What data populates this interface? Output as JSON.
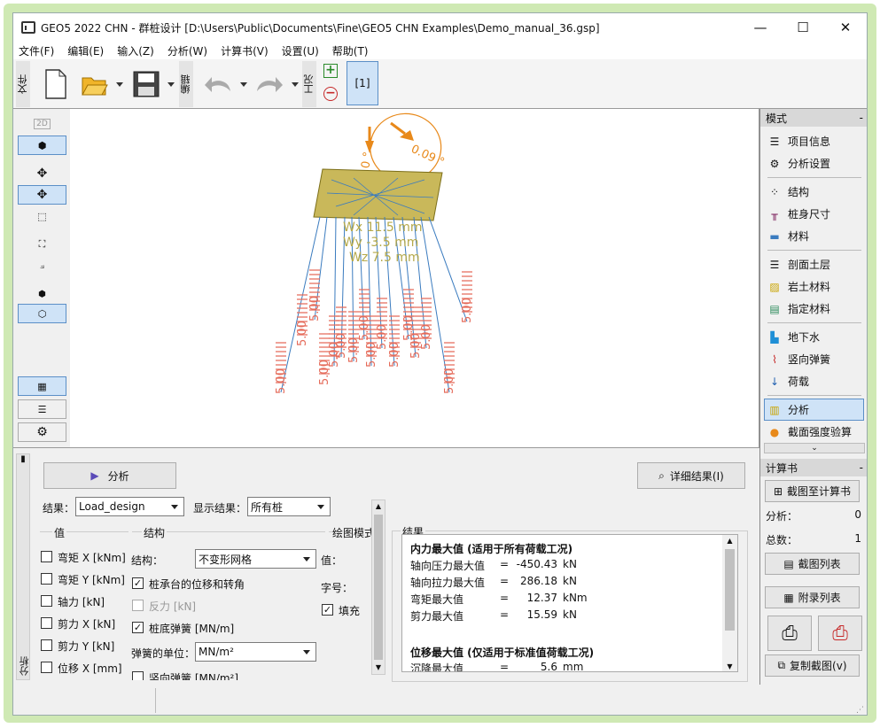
{
  "window": {
    "title": "GEO5 2022 CHN - 群桩设计 [D:\\Users\\Public\\Documents\\Fine\\GEO5 CHN Examples\\Demo_manual_36.gsp]",
    "minimize": "—",
    "maximize": "☐",
    "close": "✕"
  },
  "menu": [
    "文件(F)",
    "编辑(E)",
    "输入(Z)",
    "分析(W)",
    "计算书(V)",
    "设置(U)",
    "帮助(T)"
  ],
  "toolbar": {
    "file_label": "文件",
    "edit_label": "编辑",
    "stage_label": "工况",
    "stage_tab": "[1]"
  },
  "canvas": {
    "wx": "Wx 11.5 mm",
    "wy": "Wy -3.5 mm",
    "wz": "Wz 7.5 mm",
    "rot_label": "0.09 °",
    "rot2_label": "0.0 °",
    "springs": [
      "5.00",
      "5.00",
      "5.00",
      "5.00",
      "5.00",
      "5.00",
      "5.00",
      "5.00",
      "5.00",
      "5.00",
      "5.00",
      "5.00",
      "5.00",
      "5.00",
      "5.00",
      "5.00"
    ]
  },
  "left_tools": {
    "view2d": "2D"
  },
  "right_panel": {
    "modes_header": "模式",
    "items": [
      "项目信息",
      "分析设置",
      "结构",
      "桩身尺寸",
      "材料",
      "剖面土层",
      "岩土材料",
      "指定材料",
      "地下水",
      "竖向弹簧",
      "荷载",
      "分析",
      "截面强度验算"
    ],
    "report_header": "计算书",
    "add_report": "截图至计算书",
    "analysis_label": "分析：",
    "analysis_count": "0",
    "total_label": "总数：",
    "total_count": "1",
    "screenshot_list": "截图列表",
    "appendix_list": "附录列表",
    "copy_view": "复制截图(v)",
    "collapse": "-"
  },
  "bottom": {
    "tab_label": "分析",
    "analyze_button": "分析",
    "details_button": "详细结果(I)",
    "result_label": "结果：",
    "result_value": "Load_design",
    "show_label": "显示结果：",
    "show_value": "所有桩",
    "values_group": "值",
    "values": [
      "弯矩 X [kNm]",
      "弯矩 Y [kNm]",
      "轴力 [kN]",
      "剪力 X [kN]",
      "剪力 Y [kN]",
      "位移 X [mm]"
    ],
    "structure_group": "结构",
    "structure_label": "结构：",
    "structure_value": "不变形网格",
    "opt1": "桩承台的位移和转角",
    "opt2": "反力 [kN]",
    "opt3": "桩底弹簧 [MN/m]",
    "spring_unit_label": "弹簧的单位：",
    "spring_unit_value": "MN/m²",
    "opt4": "竖向弹簧 [MN/m²]",
    "draw_group": "绘图模式",
    "value_label": "值：",
    "font_label": "字号：",
    "fill_label": "填充",
    "results_group": "结果",
    "res_title1": "内力最大值 (适用于所有荷载工况)",
    "rows1": [
      {
        "name": "轴向压力最大值",
        "eq": "=",
        "val": "-450.43",
        "unit": "kN"
      },
      {
        "name": "轴向拉力最大值",
        "eq": "=",
        "val": "286.18",
        "unit": "kN"
      },
      {
        "name": "弯矩最大值",
        "eq": "=",
        "val": "12.37",
        "unit": "kNm"
      },
      {
        "name": "剪力最大值",
        "eq": "=",
        "val": "15.59",
        "unit": "kN"
      }
    ],
    "res_title2": "位移最大值 (仅适用于标准值荷载工况)",
    "rows2": [
      {
        "name": "沉降最大值",
        "eq": "=",
        "val": "5.6",
        "unit": "mm"
      }
    ]
  },
  "colors": {
    "selection": "#cfe3f7",
    "spring": "#e56b5a",
    "cap": "#c9b85a",
    "pile": "#3a7bbf",
    "arrow": "#e8891a"
  }
}
